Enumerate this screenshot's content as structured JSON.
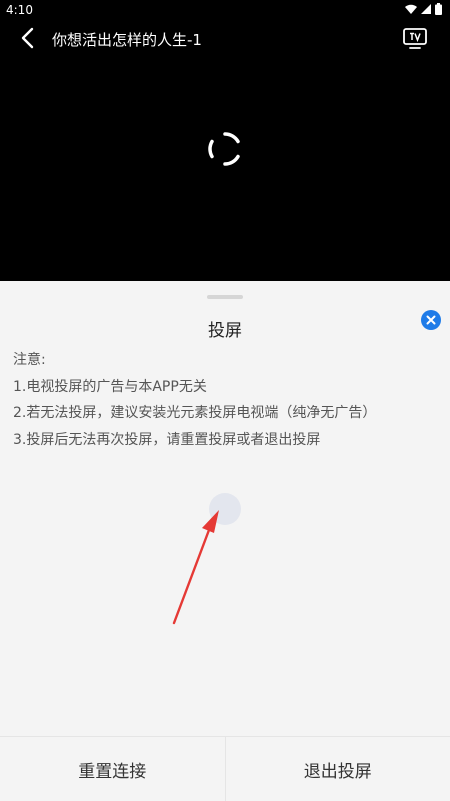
{
  "status_bar": {
    "time": "4:10",
    "icons": [
      "wifi-icon",
      "signal-icon",
      "battery-icon"
    ]
  },
  "player": {
    "title": "你想活出怎样的人生-1",
    "back_icon": "back-arrow-icon",
    "cast_icon": "tv-icon",
    "loading_icon": "spinner-icon"
  },
  "cast_sheet": {
    "title": "投屏",
    "close_icon": "close-icon",
    "notes": {
      "heading": "注意:",
      "items": [
        "1.电视投屏的广告与本APP无关",
        "2.若无法投屏，建议安装光元素投屏电视端（纯净无广告）",
        "3.投屏后无法再次投屏，请重置投屏或者退出投屏"
      ]
    },
    "buttons": {
      "reset": "重置连接",
      "exit": "退出投屏"
    }
  },
  "colors": {
    "accent": "#1e7be8",
    "arrow": "#e53935"
  }
}
